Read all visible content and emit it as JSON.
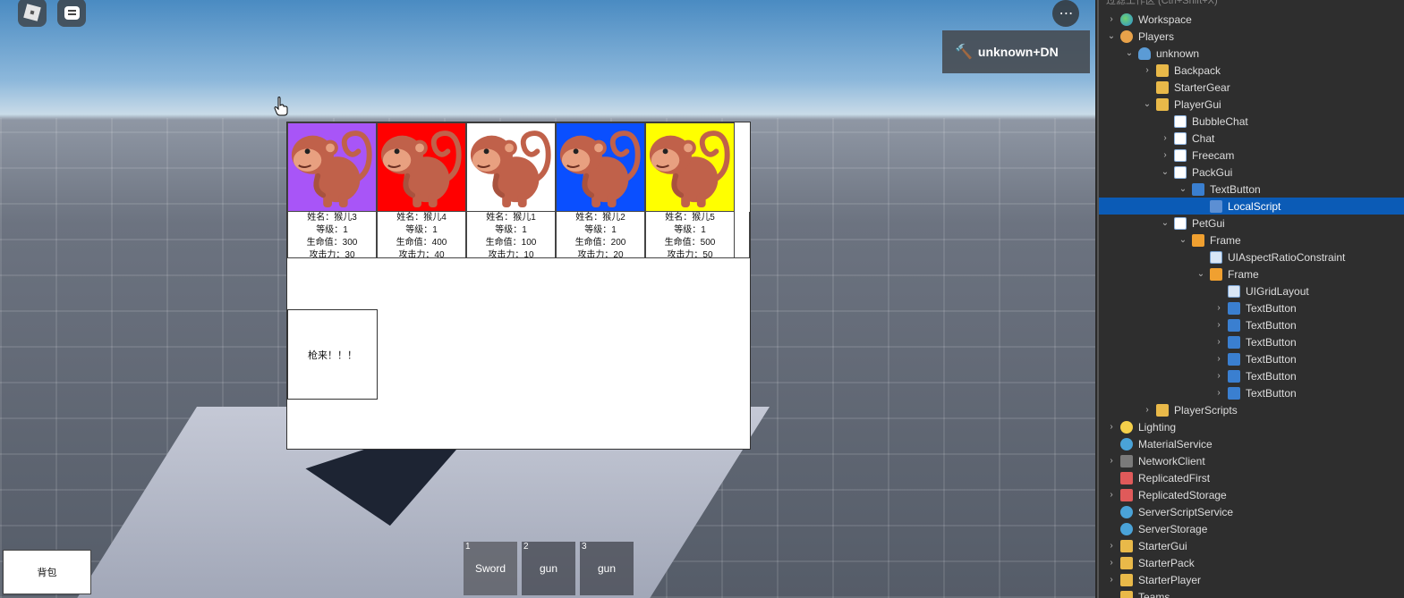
{
  "hud": {
    "player_name": "unknown+DN",
    "more_icon": "..."
  },
  "pets": [
    {
      "bg": "#a855f7",
      "name": "姓名：猴儿3",
      "level": "等级：1",
      "hp": "生命值：300",
      "atk": "攻击力：30"
    },
    {
      "bg": "#ff0000",
      "name": "姓名：猴儿4",
      "level": "等级：1",
      "hp": "生命值：400",
      "atk": "攻击力：40"
    },
    {
      "bg": "#ffffff",
      "name": "姓名：猴儿1",
      "level": "等级：1",
      "hp": "生命值：100",
      "atk": "攻击力：10"
    },
    {
      "bg": "#0a4fff",
      "name": "姓名：猴儿2",
      "level": "等级：1",
      "hp": "生命值：200",
      "atk": "攻击力：20"
    },
    {
      "bg": "#ffff00",
      "name": "姓名：猴儿5",
      "level": "等级：1",
      "hp": "生命值：500",
      "atk": "攻击力：50"
    }
  ],
  "gun_button_label": "枪来！！！",
  "backpack_label": "背包",
  "hotbar": [
    {
      "num": "1",
      "label": "Sword"
    },
    {
      "num": "2",
      "label": "gun"
    },
    {
      "num": "3",
      "label": "gun"
    }
  ],
  "explorer": {
    "filter_placeholder": "过滤工作区 (Ctrl+Shift+X)",
    "rows": [
      {
        "label": "Workspace",
        "chev": "›",
        "icon": "globe"
      },
      {
        "label": "Players",
        "chev": "⌄",
        "icon": "players"
      },
      {
        "label": "unknown",
        "chev": "⌄",
        "icon": "player"
      },
      {
        "label": "Backpack",
        "chev": "›",
        "icon": "folder"
      },
      {
        "label": "StarterGear",
        "chev": "",
        "icon": "folder"
      },
      {
        "label": "PlayerGui",
        "chev": "⌄",
        "icon": "folder"
      },
      {
        "label": "BubbleChat",
        "chev": "",
        "icon": "gui"
      },
      {
        "label": "Chat",
        "chev": "›",
        "icon": "gui"
      },
      {
        "label": "Freecam",
        "chev": "›",
        "icon": "gui"
      },
      {
        "label": "PackGui",
        "chev": "⌄",
        "icon": "gui"
      },
      {
        "label": "TextButton",
        "chev": "⌄",
        "icon": "btn"
      },
      {
        "label": "LocalScript",
        "chev": "",
        "icon": "script",
        "selected": true
      },
      {
        "label": "PetGui",
        "chev": "⌄",
        "icon": "gui"
      },
      {
        "label": "Frame",
        "chev": "⌄",
        "icon": "frame"
      },
      {
        "label": "UIAspectRatioConstraint",
        "chev": "",
        "icon": "constraint"
      },
      {
        "label": "Frame",
        "chev": "⌄",
        "icon": "frame"
      },
      {
        "label": "UIGridLayout",
        "chev": "",
        "icon": "constraint"
      },
      {
        "label": "TextButton",
        "chev": "›",
        "icon": "btn"
      },
      {
        "label": "TextButton",
        "chev": "›",
        "icon": "btn"
      },
      {
        "label": "TextButton",
        "chev": "›",
        "icon": "btn"
      },
      {
        "label": "TextButton",
        "chev": "›",
        "icon": "btn"
      },
      {
        "label": "TextButton",
        "chev": "›",
        "icon": "btn"
      },
      {
        "label": "TextButton",
        "chev": "›",
        "icon": "btn"
      },
      {
        "label": "PlayerScripts",
        "chev": "›",
        "icon": "folder"
      },
      {
        "label": "Lighting",
        "chev": "›",
        "icon": "light"
      },
      {
        "label": "MaterialService",
        "chev": "",
        "icon": "service"
      },
      {
        "label": "NetworkClient",
        "chev": "›",
        "icon": "net"
      },
      {
        "label": "ReplicatedFirst",
        "chev": "",
        "icon": "repl"
      },
      {
        "label": "ReplicatedStorage",
        "chev": "›",
        "icon": "repl"
      },
      {
        "label": "ServerScriptService",
        "chev": "",
        "icon": "service"
      },
      {
        "label": "ServerStorage",
        "chev": "",
        "icon": "service"
      },
      {
        "label": "StarterGui",
        "chev": "›",
        "icon": "folder"
      },
      {
        "label": "StarterPack",
        "chev": "›",
        "icon": "folder"
      },
      {
        "label": "StarterPlayer",
        "chev": "›",
        "icon": "folder"
      },
      {
        "label": "Teams",
        "chev": "",
        "icon": "folder"
      }
    ]
  }
}
